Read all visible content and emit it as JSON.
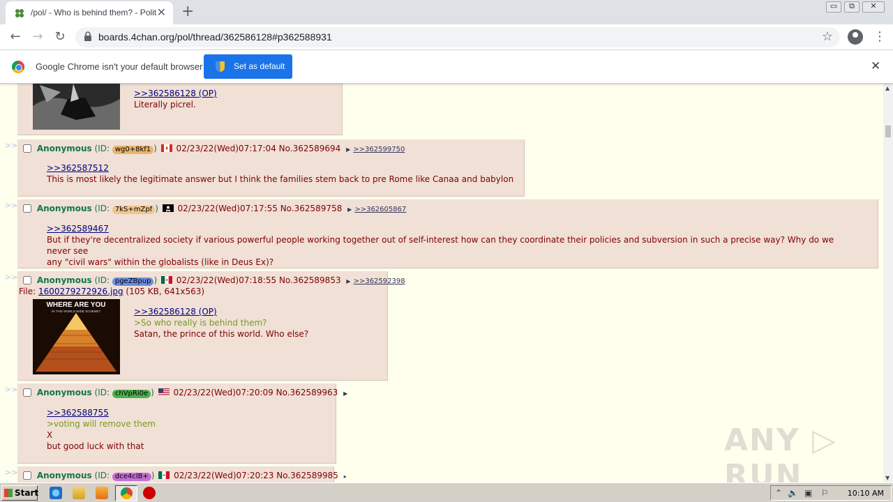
{
  "browser": {
    "tab_title": "/pol/ - Who is behind them? - Politica",
    "tab_close": "✕",
    "new_tab": "+",
    "url": "boards.4chan.org/pol/thread/362586128#p362588931",
    "win_min": "▭",
    "win_max": "⧉",
    "win_close": "✕",
    "back": "←",
    "forward": "→",
    "reload": "↻",
    "star": "☆",
    "menu": "⋮"
  },
  "infobar": {
    "message": "Google Chrome isn't your default browser",
    "button": "Set as default",
    "close": "✕"
  },
  "thread": {
    "arrows": ">>",
    "top_post": {
      "quote": ">>362586128 (OP)",
      "text": "Literally picrel."
    },
    "posts": [
      {
        "name": "Anonymous",
        "id_prefix": "(ID: ",
        "uid": "wg0+8kf1",
        "uid_color": "#e9b46d",
        "id_suffix": ")",
        "flag": "Canada",
        "datetime": "02/23/22(Wed)07:17:04",
        "no": "No.362589694",
        "backlink": ">>362599750",
        "quote": ">>362587512",
        "lines": [
          "This is most likely the legitimate answer but I think the families stem back to pre Rome like Canaa and babylon"
        ]
      },
      {
        "name": "Anonymous",
        "id_prefix": "(ID: ",
        "uid": "7kS+mZpf",
        "uid_color": "#f0c58e",
        "id_suffix": ")",
        "flag": "Pirate",
        "datetime": "02/23/22(Wed)07:17:55",
        "no": "No.362589758",
        "backlink": ">>362605867",
        "quote": ">>362589467",
        "lines": [
          "But if they're decentralized society if various powerful people working together out of self-interest how can they coordinate their policies and subversion in such a precise way? Why do we never see",
          "any \"civil wars\" within the globalists (like in Deus Ex)?"
        ]
      },
      {
        "name": "Anonymous",
        "id_prefix": "(ID: ",
        "uid": "pgeZBpup",
        "uid_color": "#6e8fe0",
        "id_suffix": ")",
        "flag": "Mexico",
        "datetime": "02/23/22(Wed)07:18:55",
        "no": "No.362589853",
        "backlink": ">>362592398",
        "file_label": "File: ",
        "file_name": "1600279272926.jpg",
        "file_meta": " (105 KB, 641x563)",
        "thumb_text_1": "WHERE ARE YOU",
        "thumb_text_2": "IN THIS WORLD WIDE SCHEME?",
        "quote": ">>362586128 (OP)",
        "green": ">So who really is behind them?",
        "lines": [
          "Satan, the prince of this world. Who else?"
        ]
      },
      {
        "name": "Anonymous",
        "id_prefix": "(ID: ",
        "uid": "chVpRi0e",
        "uid_color": "#4caf50",
        "id_suffix": ")",
        "flag": "United States",
        "datetime": "02/23/22(Wed)07:20:09",
        "no": "No.362589963",
        "quote": ">>362588755",
        "green": ">voting will remove them",
        "lines": [
          "X",
          "but good luck with that"
        ]
      },
      {
        "name": "Anonymous",
        "id_prefix": "(ID: ",
        "uid": "dce4clB+",
        "uid_color": "#c46fd6",
        "id_suffix": ")",
        "flag": "Mexico",
        "datetime": "02/23/22(Wed)07:20:23",
        "no": "No.362589985",
        "backlink": "▸"
      }
    ]
  },
  "watermark": "ANY ▷ RUN",
  "taskbar": {
    "start": "Start",
    "clock": "10:10 AM"
  }
}
